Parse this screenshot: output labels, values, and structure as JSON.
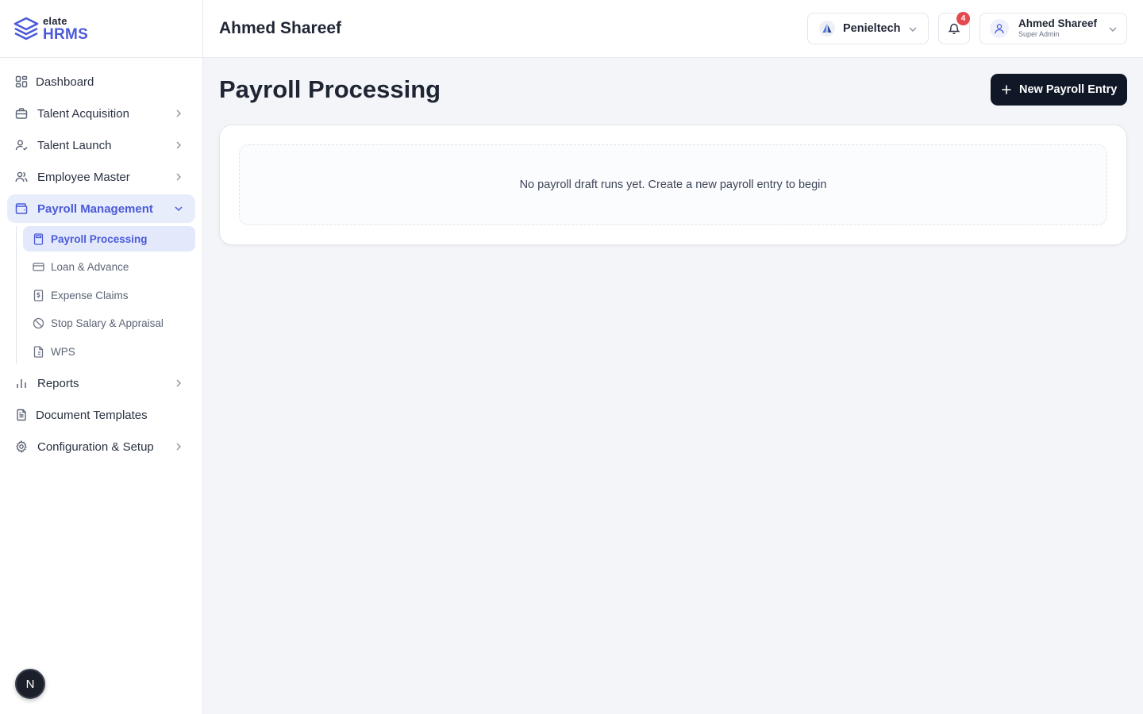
{
  "brand": {
    "small": "elate",
    "big": "HRMS",
    "color": "#4a5ad8",
    "icon": "layers-logo-icon"
  },
  "header": {
    "title": "Ahmed Shareef",
    "org_name": "Penieltech",
    "notifications_count": "4",
    "user_name": "Ahmed Shareef",
    "user_role": "Super Admin"
  },
  "sidebar": {
    "items": [
      {
        "label": "Dashboard",
        "icon": "dashboard-icon"
      },
      {
        "label": "Talent Acquisition",
        "icon": "briefcase-icon"
      },
      {
        "label": "Talent Launch",
        "icon": "user-check-icon"
      },
      {
        "label": "Employee Master",
        "icon": "users-icon"
      },
      {
        "label": "Payroll Management",
        "icon": "wallet-icon"
      },
      {
        "label": "Reports",
        "icon": "bar-chart-icon"
      },
      {
        "label": "Document Templates",
        "icon": "document-icon"
      },
      {
        "label": "Configuration & Setup",
        "icon": "gear-icon"
      }
    ],
    "payroll_sub": [
      {
        "label": "Payroll Processing",
        "icon": "calculator-icon"
      },
      {
        "label": "Loan & Advance",
        "icon": "credit-card-icon"
      },
      {
        "label": "Expense Claims",
        "icon": "receipt-icon"
      },
      {
        "label": "Stop Salary & Appraisal",
        "icon": "ban-icon"
      },
      {
        "label": "WPS",
        "icon": "file-list-icon"
      }
    ],
    "footer_badge": "N"
  },
  "main": {
    "page_title": "Payroll Processing",
    "new_button_label": "New Payroll Entry",
    "empty_message": "No payroll draft runs yet. Create a new payroll entry to begin"
  },
  "colors": {
    "accent": "#4a5ad8",
    "active_bg": "#e8edfb",
    "primary_button": "#101828",
    "badge_red": "#e5484d"
  }
}
